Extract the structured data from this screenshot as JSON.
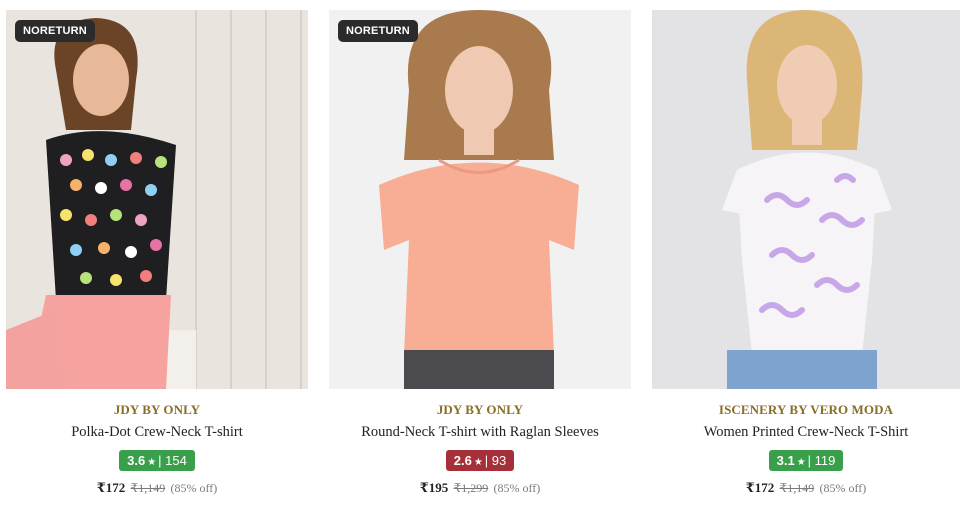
{
  "products": [
    {
      "badge": "NORETURN",
      "brand": "JDY BY ONLY",
      "name": "Polka-Dot Crew-Neck T-shirt",
      "rating": "3.6",
      "rating_count": "154",
      "rating_color": "#3a9f4a",
      "price": "₹172",
      "mrp": "₹1,149",
      "discount": "(85% off)"
    },
    {
      "badge": "NORETURN",
      "brand": "JDY BY ONLY",
      "name": "Round-Neck T-shirt with Raglan Sleeves",
      "rating": "2.6",
      "rating_count": "93",
      "rating_color": "#a5303a",
      "price": "₹195",
      "mrp": "₹1,299",
      "discount": "(85% off)"
    },
    {
      "badge": "",
      "brand": "ISCENERY BY VERO MODA",
      "name": "Women Printed Crew-Neck T-Shirt",
      "rating": "3.1",
      "rating_count": "119",
      "rating_color": "#3a9f4a",
      "price": "₹172",
      "mrp": "₹1,149",
      "discount": "(85% off)"
    }
  ]
}
